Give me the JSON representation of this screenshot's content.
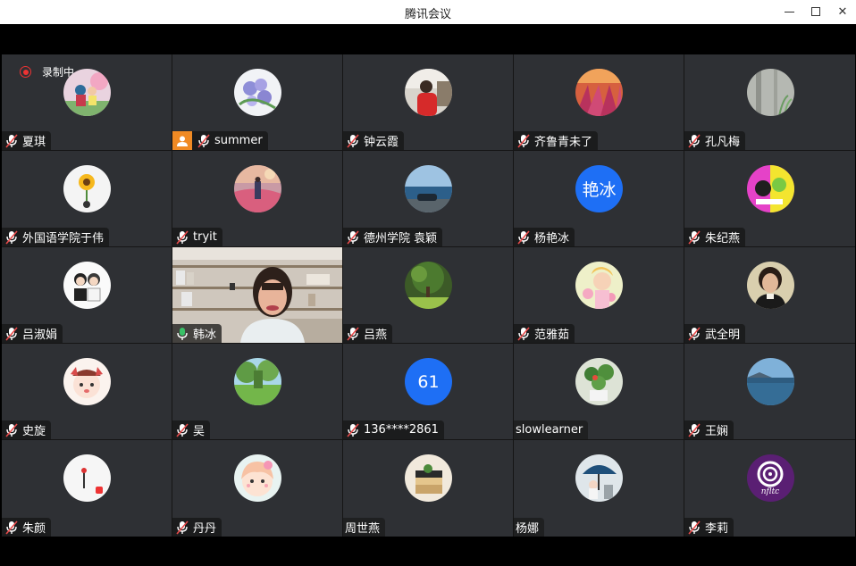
{
  "window": {
    "title": "腾讯会议",
    "minimize_icon": "minimize-icon",
    "maximize_icon": "maximize-icon",
    "close_icon": "close-icon"
  },
  "recording": {
    "label": "录制中",
    "icon": "record-icon",
    "color": "#e33333"
  },
  "colors": {
    "tile_bg": "#2e3034",
    "active_speaker_border": "#4cc373",
    "host_badge": "#f08a24",
    "text_avatar": "#1e6ff5"
  },
  "participants": [
    {
      "name": "夏琪",
      "muted": true
    },
    {
      "name": "summer",
      "muted": true,
      "host": true
    },
    {
      "name": "钟云霞",
      "muted": true
    },
    {
      "name": "齐鲁青未了",
      "muted": true
    },
    {
      "name": "孔凡梅",
      "muted": true
    },
    {
      "name": "外国语学院于伟",
      "muted": true
    },
    {
      "name": "tryit",
      "muted": true
    },
    {
      "name": "德州学院 袁颖",
      "muted": true
    },
    {
      "name": "杨艳冰",
      "muted": true,
      "avatar_text": "艳冰"
    },
    {
      "name": "朱纪燕",
      "muted": true
    },
    {
      "name": "吕淑娟",
      "muted": true
    },
    {
      "name": "韩冰",
      "muted": false,
      "video": true
    },
    {
      "name": "吕燕",
      "muted": true
    },
    {
      "name": "范雅茹",
      "muted": true
    },
    {
      "name": "武全明",
      "muted": true
    },
    {
      "name": "史旋",
      "muted": true
    },
    {
      "name": "吴",
      "muted": true
    },
    {
      "name": "136****2861",
      "muted": true,
      "avatar_text": "61"
    },
    {
      "name": "slowlearner",
      "muted": null
    },
    {
      "name": "王娴",
      "muted": true
    },
    {
      "name": "朱颜",
      "muted": true
    },
    {
      "name": "丹丹",
      "muted": true
    },
    {
      "name": "周世燕",
      "muted": null
    },
    {
      "name": "杨娜",
      "muted": null
    },
    {
      "name": "李莉",
      "muted": true
    }
  ]
}
